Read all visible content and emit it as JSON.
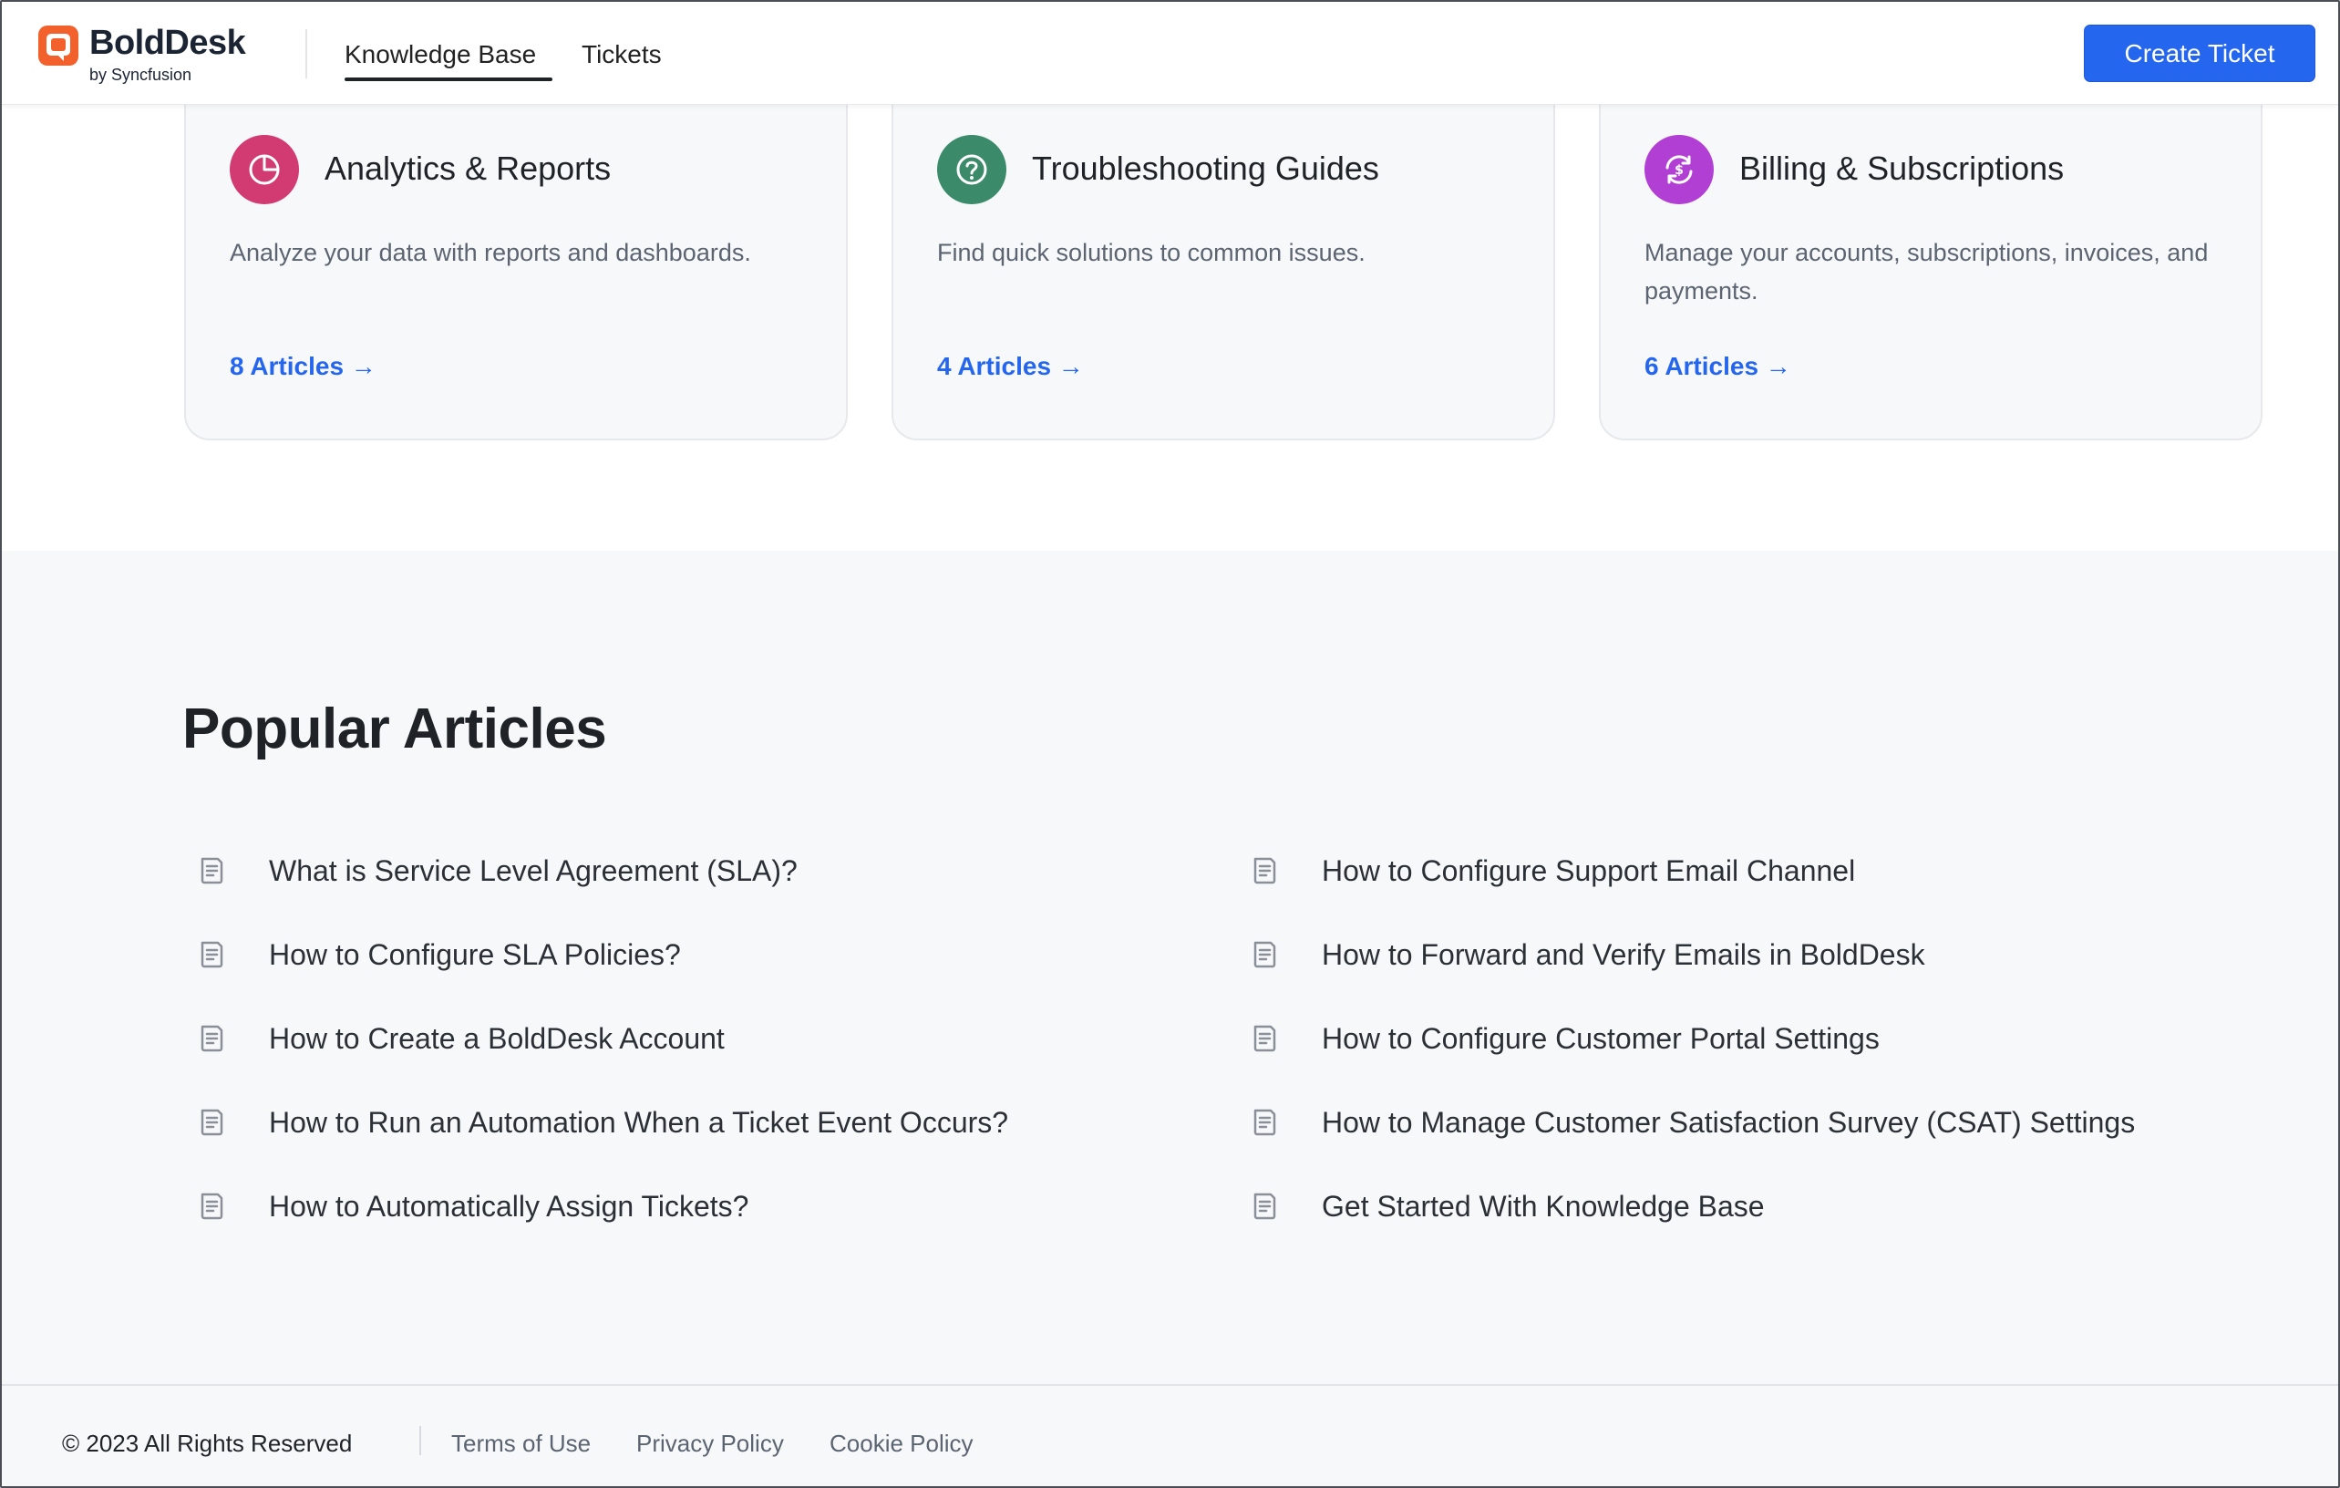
{
  "header": {
    "brand_name": "BoldDesk",
    "brand_sub": "by Syncfusion",
    "nav": [
      {
        "label": "Knowledge Base",
        "active": true
      },
      {
        "label": "Tickets",
        "active": false
      }
    ],
    "create_ticket_label": "Create Ticket",
    "accent_color": "#2466ee",
    "logo_color": "#f2612b"
  },
  "categories": [
    {
      "title": "Analytics & Reports",
      "description": "Analyze your data with reports and dashboards.",
      "link": "8 Articles →",
      "icon": "pie-chart-icon",
      "icon_color": "#d23a72"
    },
    {
      "title": "Troubleshooting Guides",
      "description": "Find quick solutions to common issues.",
      "link": "4 Articles →",
      "icon": "help-circle-icon",
      "icon_color": "#3b8a69"
    },
    {
      "title": "Billing & Subscriptions",
      "description": "Manage your accounts, subscriptions, invoices, and payments.",
      "link": "6 Articles →",
      "icon": "currency-exchange-icon",
      "icon_color": "#b23fd4"
    }
  ],
  "popular": {
    "title": "Popular Articles",
    "left_articles": [
      "What is Service Level Agreement (SLA)?",
      "How to Configure SLA Policies?",
      "How to Create a BoldDesk Account",
      "How to Run an Automation When a Ticket Event Occurs?",
      "How to Automatically Assign Tickets?"
    ],
    "right_articles": [
      "How to Configure Support Email Channel",
      "How to Forward and Verify Emails in BoldDesk",
      "How to Configure Customer Portal Settings",
      "How to Manage Customer Satisfaction Survey (CSAT) Settings",
      "Get Started With Knowledge Base"
    ]
  },
  "footer": {
    "copyright": "© 2023 All Rights Reserved",
    "links": [
      "Terms of Use",
      "Privacy Policy",
      "Cookie Policy"
    ]
  }
}
